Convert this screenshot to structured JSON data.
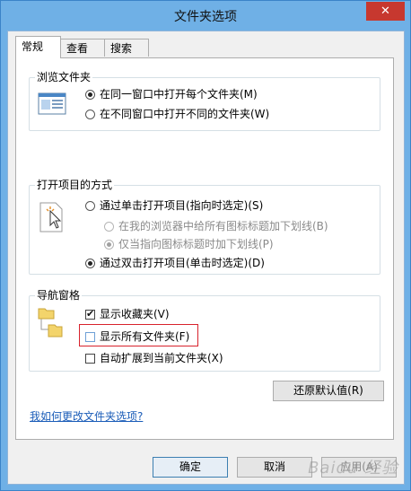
{
  "window": {
    "title": "文件夹选项",
    "close_glyph": "✕"
  },
  "tabs": [
    {
      "label": "常规",
      "active": true
    },
    {
      "label": "查看",
      "active": false
    },
    {
      "label": "搜索",
      "active": false
    }
  ],
  "browse_group": {
    "title": "浏览文件夹",
    "options": [
      {
        "label": "在同一窗口中打开每个文件夹(M)",
        "checked": true
      },
      {
        "label": "在不同窗口中打开不同的文件夹(W)",
        "checked": false
      }
    ]
  },
  "click_group": {
    "title": "打开项目的方式",
    "options": [
      {
        "label": "通过单击打开项目(指向时选定)(S)",
        "checked": false
      },
      {
        "label": "在我的浏览器中给所有图标标题加下划线(B)",
        "checked": false,
        "disabled": true
      },
      {
        "label": "仅当指向图标标题时加下划线(P)",
        "checked": true,
        "disabled": true
      },
      {
        "label": "通过双击打开项目(单击时选定)(D)",
        "checked": true
      }
    ]
  },
  "nav_group": {
    "title": "导航窗格",
    "options": [
      {
        "label": "显示收藏夹(V)",
        "checked": true
      },
      {
        "label": "显示所有文件夹(F)",
        "checked": false
      },
      {
        "label": "自动扩展到当前文件夹(X)",
        "checked": false
      }
    ]
  },
  "restore_button": "还原默认值(R)",
  "help_link": "我如何更改文件夹选项?",
  "footer": {
    "ok": "确定",
    "cancel": "取消",
    "apply": "应用(A)"
  },
  "watermark": "Baidu 经验",
  "colors": {
    "highlight_border": "#d8222c",
    "titlebar": "#6fb0e6",
    "link": "#1a5cb8"
  }
}
